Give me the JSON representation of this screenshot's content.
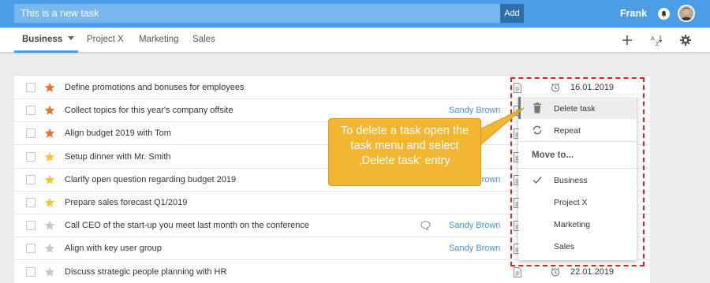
{
  "topbar": {
    "task_input_value": "This is a new task",
    "add_label": "Add",
    "user_name": "Frank"
  },
  "tabs": [
    {
      "label": "Business",
      "active": true
    },
    {
      "label": "Project X"
    },
    {
      "label": "Marketing"
    },
    {
      "label": "Sales"
    }
  ],
  "tools": [
    "plus-icon",
    "sort-az-icon",
    "gear-icon"
  ],
  "tasks": [
    {
      "title": "Define promotions and bonuses for employees",
      "star": "orange",
      "assignee": "",
      "date": "16.01.2019"
    },
    {
      "title": "Collect topics for this year's company offsite",
      "star": "orange",
      "assignee": "Sandy Brown",
      "date": ""
    },
    {
      "title": "Align budget 2019 with Tom",
      "star": "orange",
      "assignee": "",
      "date": ""
    },
    {
      "title": "Setup dinner with Mr. Smith",
      "star": "yellow",
      "assignee": "",
      "date": ""
    },
    {
      "title": "Clarify open question regarding budget 2019",
      "star": "yellow",
      "assignee": "Sandy Brown",
      "date": ""
    },
    {
      "title": "Prepare sales forecast Q1/2019",
      "star": "yellow",
      "assignee": "",
      "date": ""
    },
    {
      "title": "Call CEO of the start-up you meet last month on the conference",
      "star": "grey",
      "assignee": "Sandy Brown",
      "date": ""
    },
    {
      "title": "Align with key user group",
      "star": "grey",
      "assignee": "Sandy Brown",
      "date": ""
    },
    {
      "title": "Discuss strategic people planning with HR",
      "star": "grey",
      "assignee": "",
      "date": "22.01.2019"
    }
  ],
  "menu": {
    "delete_label": "Delete task",
    "repeat_label": "Repeat",
    "move_to_label": "Move to...",
    "targets": [
      {
        "label": "Business",
        "checked": true
      },
      {
        "label": "Project X"
      },
      {
        "label": "Marketing"
      },
      {
        "label": "Sales"
      }
    ]
  },
  "callout": {
    "lines": [
      "To delete a task open the",
      "task menu and select",
      "‚Delete task‘ entry"
    ]
  },
  "colors": {
    "header_blue": "#4b9ee6",
    "input_blue": "#78b8ef",
    "add_button": "#2f6fab",
    "link_blue": "#4a90d9",
    "star_orange": "#e8742c",
    "star_yellow": "#f3c53a",
    "star_grey": "#c8c8c8",
    "callout_yellow": "#f2b632",
    "highlight_red": "#e02020"
  }
}
